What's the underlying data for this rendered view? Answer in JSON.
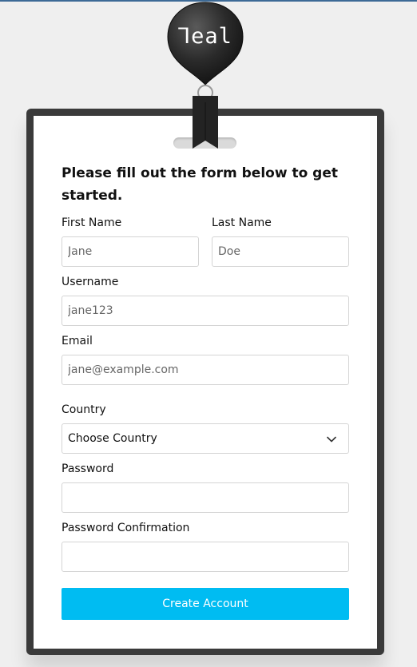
{
  "logo": {
    "text": "ꓶeal",
    "alt": "real"
  },
  "form": {
    "title": "Please fill out the form below to get started.",
    "first_name": {
      "label": "First Name",
      "placeholder": "Jane",
      "value": ""
    },
    "last_name": {
      "label": "Last Name",
      "placeholder": "Doe",
      "value": ""
    },
    "username": {
      "label": "Username",
      "placeholder": "jane123",
      "value": ""
    },
    "email": {
      "label": "Email",
      "placeholder": "jane@example.com",
      "value": ""
    },
    "country": {
      "label": "Country",
      "selected": "Choose Country"
    },
    "password": {
      "label": "Password",
      "placeholder": "",
      "value": ""
    },
    "password_confirmation": {
      "label": "Password Confirmation",
      "placeholder": "",
      "value": ""
    },
    "submit_label": "Create Account"
  },
  "colors": {
    "accent": "#00bcf2",
    "badge_frame": "#3a3a3a",
    "background": "#efefef",
    "pendant": "#232323"
  },
  "icons": {
    "country_select": "chevron-down-icon",
    "logo": "real-logo-pendant"
  }
}
